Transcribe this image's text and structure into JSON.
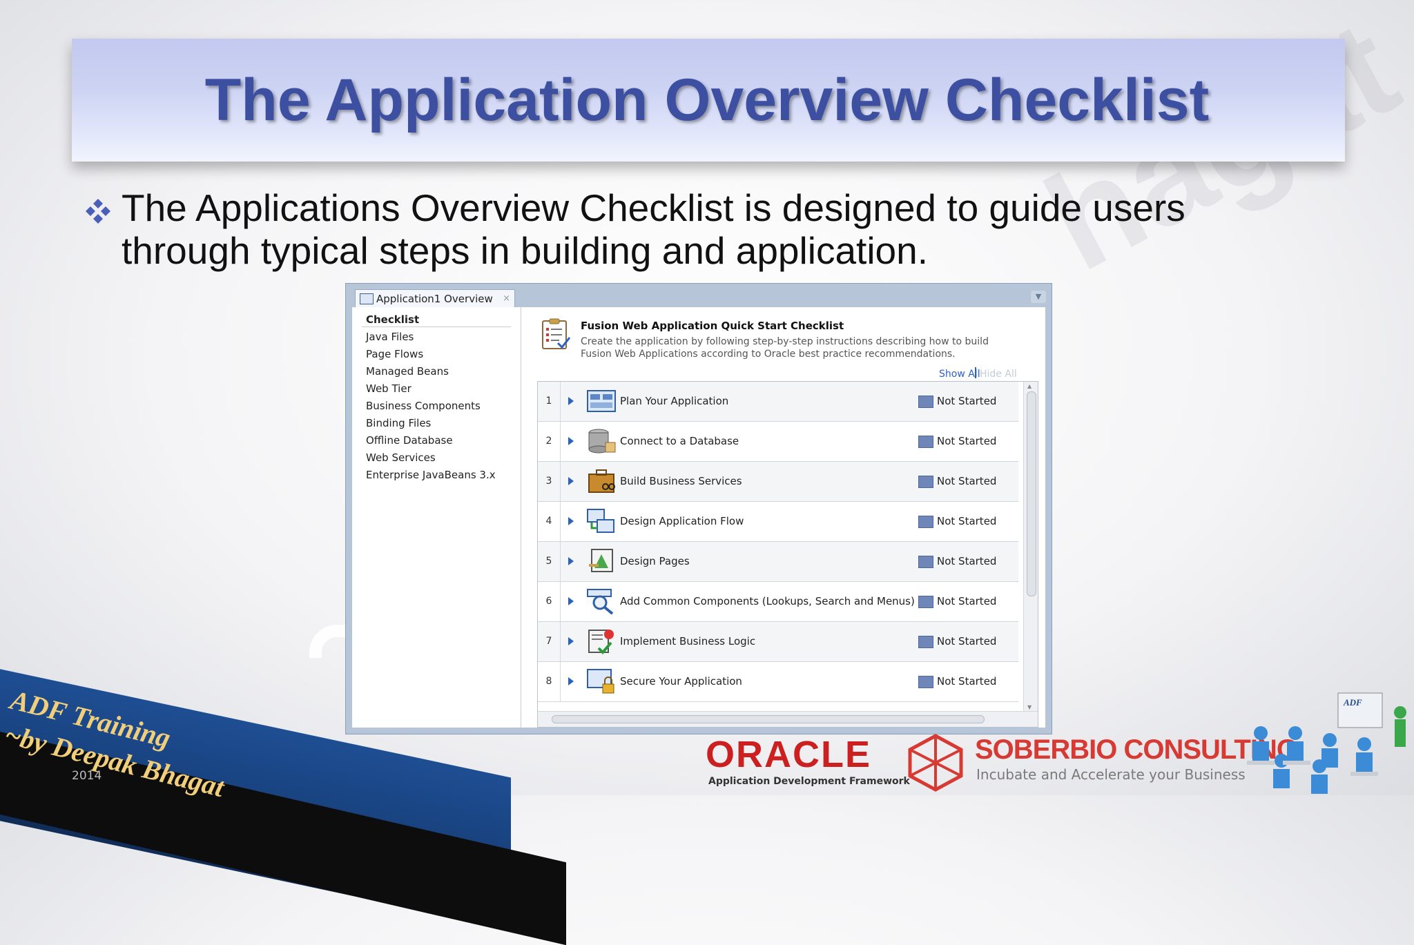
{
  "slide": {
    "title": "The Application Overview Checklist",
    "bullet": "The Applications Overview Checklist is designed to guide users through typical steps in building and application."
  },
  "ide": {
    "tab_label": "Application1 Overview",
    "tab_close": "×",
    "nav_items": [
      {
        "label": "Checklist",
        "selected": true
      },
      {
        "label": "Java Files"
      },
      {
        "label": "Page Flows"
      },
      {
        "label": "Managed Beans"
      },
      {
        "label": "Web Tier"
      },
      {
        "label": "Business Components"
      },
      {
        "label": "Binding Files"
      },
      {
        "label": "Offline Database"
      },
      {
        "label": "Web Services"
      },
      {
        "label": "Enterprise JavaBeans 3.x"
      }
    ],
    "quick_start": {
      "title": "Fusion Web Application Quick Start Checklist",
      "description": "Create the application by following step-by-step instructions describing how to build Fusion Web Applications according to Oracle best practice recommendations.",
      "show_all": "Show All",
      "hide_all": "Hide All"
    },
    "steps": [
      {
        "num": "1",
        "label": "Plan Your Application",
        "status": "Not Started",
        "icon": "plan-icon"
      },
      {
        "num": "2",
        "label": "Connect to a Database",
        "status": "Not Started",
        "icon": "database-icon"
      },
      {
        "num": "3",
        "label": "Build Business Services",
        "status": "Not Started",
        "icon": "briefcase-icon"
      },
      {
        "num": "4",
        "label": "Design Application Flow",
        "status": "Not Started",
        "icon": "flow-icon"
      },
      {
        "num": "5",
        "label": "Design Pages",
        "status": "Not Started",
        "icon": "design-pages-icon"
      },
      {
        "num": "6",
        "label": "Add Common Components (Lookups, Search and Menus)",
        "status": "Not Started",
        "icon": "search-component-icon"
      },
      {
        "num": "7",
        "label": "Implement Business Logic",
        "status": "Not Started",
        "icon": "business-logic-icon"
      },
      {
        "num": "8",
        "label": "Secure Your Application",
        "status": "Not Started",
        "icon": "lock-icon"
      }
    ]
  },
  "footer": {
    "training_line1": "ADF Training",
    "training_line2": "~by Deepak Bhagat",
    "year": "2014",
    "oracle": "ORACLE",
    "oracle_sub": "Application Development Framework",
    "company": "SOBERBIO CONSULTING",
    "tagline": "Incubate and Accelerate your Business",
    "people_badge": "ADF"
  },
  "colors": {
    "title": "#3d4fa0",
    "status_box": "#6e86b8",
    "link": "#2a62c4",
    "oracle_red": "#cc1f1f",
    "soberbio_red": "#d63a33"
  }
}
